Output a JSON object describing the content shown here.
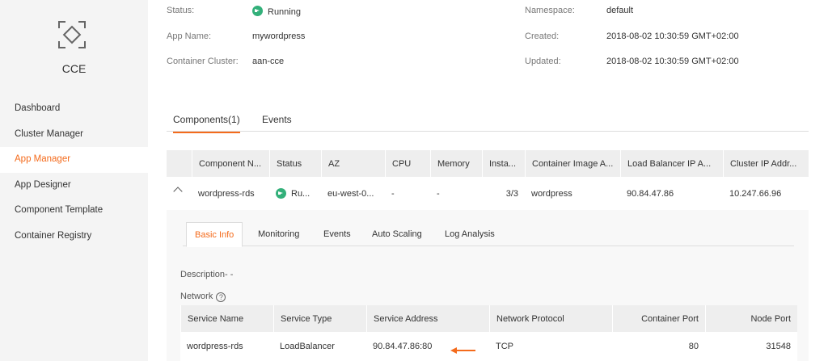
{
  "sidebar": {
    "logo_text": "CCE",
    "items": [
      {
        "label": "Dashboard"
      },
      {
        "label": "Cluster Manager"
      },
      {
        "label": "App Manager"
      },
      {
        "label": "App Designer"
      },
      {
        "label": "Component Template"
      },
      {
        "label": "Container Registry"
      }
    ],
    "active_index": 2
  },
  "info": {
    "status_label": "Status:",
    "status_value": "Running",
    "app_name_label": "App Name:",
    "app_name_value": "mywordpress",
    "cluster_label": "Container Cluster:",
    "cluster_value": "aan-cce",
    "namespace_label": "Namespace:",
    "namespace_value": "default",
    "created_label": "Created:",
    "created_value": "2018-08-02 10:30:59 GMT+02:00",
    "updated_label": "Updated:",
    "updated_value": "2018-08-02 10:30:59 GMT+02:00"
  },
  "tabs": [
    {
      "label": "Components(1)"
    },
    {
      "label": "Events"
    }
  ],
  "components_table": {
    "headers": [
      "Component N...",
      "Status",
      "AZ",
      "CPU",
      "Memory",
      "Insta...",
      "Container Image A...",
      "Load Balancer IP A...",
      "Cluster IP Addr..."
    ],
    "row": {
      "name": "wordpress-rds",
      "status": "Ru...",
      "az": "eu-west-0...",
      "cpu": "-",
      "memory": "-",
      "instances": "3/3",
      "image": "wordpress",
      "lb_ip": "90.84.47.86",
      "cluster_ip": "10.247.66.96"
    }
  },
  "detail": {
    "subtabs": [
      {
        "label": "Basic Info"
      },
      {
        "label": "Monitoring"
      },
      {
        "label": "Events"
      },
      {
        "label": "Auto Scaling"
      },
      {
        "label": "Log Analysis"
      }
    ],
    "description_label": "Description- -",
    "network_label": "Network"
  },
  "service_table": {
    "headers": [
      "Service Name",
      "Service Type",
      "Service Address",
      "Network Protocol",
      "Container Port",
      "Node Port"
    ],
    "row": {
      "name": "wordpress-rds",
      "type": "LoadBalancer",
      "address": "90.84.47.86:80",
      "protocol": "TCP",
      "container_port": "80",
      "node_port": "31548"
    }
  },
  "colors": {
    "accent": "#f46b1c",
    "running": "#33b07a",
    "sidebar_bg": "#f4f4f4"
  },
  "icons": [
    "cce-logo-icon",
    "running-icon",
    "collapse-chevron-icon",
    "help-icon",
    "arrow-left-icon"
  ]
}
